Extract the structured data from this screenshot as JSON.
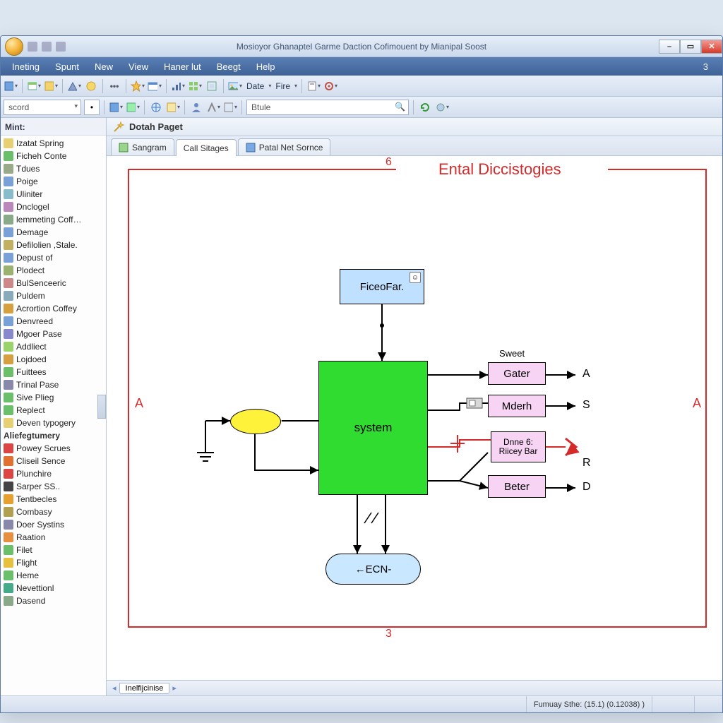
{
  "title": "Mosioyor Ghanaptel Garme Daction Cofimouent by Mianipal Soost",
  "menubar": {
    "items": [
      "Ineting",
      "Spunt",
      "New",
      "View",
      "Haner lut",
      "Beegt",
      "Help"
    ],
    "right_num": "3"
  },
  "toolbar1": {
    "labels": {
      "date": "Date",
      "fire": "Fire"
    }
  },
  "toolbar2": {
    "combo": "scord",
    "search": "Btule"
  },
  "sidebar": {
    "header": "Mint:",
    "items": [
      {
        "label": "Izatat Spring",
        "color": "#e7d073"
      },
      {
        "label": "Ficheh Conte",
        "color": "#6bbf6b"
      },
      {
        "label": "Tdues",
        "color": "#9a8"
      },
      {
        "label": "Poige",
        "color": "#7aa0d8"
      },
      {
        "label": "Uliniter",
        "color": "#8bc"
      },
      {
        "label": "Dnclogel",
        "color": "#b8b"
      },
      {
        "label": "lemmeting Coff…",
        "color": "#8a8"
      },
      {
        "label": "Demage",
        "color": "#7aa0d8"
      },
      {
        "label": "Defilolien ,Stale.",
        "color": "#c0b060"
      },
      {
        "label": "Depust of",
        "color": "#7aa0d8"
      },
      {
        "label": "Plodect",
        "color": "#9bb170"
      },
      {
        "label": "BulSenceeric",
        "color": "#c88"
      },
      {
        "label": "Puldem",
        "color": "#8ab"
      },
      {
        "label": "Acrortion Coffey",
        "color": "#d6a040"
      },
      {
        "label": "Denvreed",
        "color": "#7aa0d8"
      },
      {
        "label": "Mgoer Pase",
        "color": "#88c"
      },
      {
        "label": "Addliect",
        "color": "#9bd36b"
      },
      {
        "label": "Lojdoed",
        "color": "#d6a040"
      },
      {
        "label": "Fuittees",
        "color": "#6bbf6b"
      },
      {
        "label": "Trinal Pase",
        "color": "#88a"
      },
      {
        "label": "Sive Plieg",
        "color": "#6bbf6b"
      },
      {
        "label": "Replect",
        "color": "#6bbf6b"
      },
      {
        "label": "Deven typogery",
        "color": "#e7d073"
      }
    ],
    "group2_label": "Aliefegtumery",
    "items2": [
      {
        "label": "Powey Scrues",
        "color": "#d44"
      },
      {
        "label": "Cliseil Sence",
        "color": "#e27030"
      },
      {
        "label": "Plunchire",
        "color": "#d44"
      },
      {
        "label": "Sarper SS..",
        "color": "#444"
      },
      {
        "label": "Tentbecles",
        "color": "#e7a030"
      },
      {
        "label": "Combasy",
        "color": "#b0a050"
      },
      {
        "label": "Doer Systins",
        "color": "#88a"
      },
      {
        "label": "Raation",
        "color": "#e79040"
      },
      {
        "label": "Filet",
        "color": "#6bbf6b"
      },
      {
        "label": "Flight",
        "color": "#e7c040"
      },
      {
        "label": "Heme",
        "color": "#6bbf6b"
      },
      {
        "label": "Nevettionl",
        "color": "#4a8"
      },
      {
        "label": "Dasend",
        "color": "#8a8"
      }
    ]
  },
  "crumb": "Dotah Paget",
  "tabs": [
    {
      "label": "Sangram"
    },
    {
      "label": "Call Sitages"
    },
    {
      "label": "Patal Net Sornce"
    }
  ],
  "diagram": {
    "title": "Ental Diccistogies",
    "top_num": "6",
    "bottom_num": "3",
    "leftA": "A",
    "rightA": "A",
    "top_box": "FiceoFar.",
    "center": "system",
    "ecn": "←ECN-",
    "sweet": "Sweet",
    "b1": "Gater",
    "b2": "Mderh",
    "b3l1": "Dnne 6:",
    "b3l2": "Riicey Bar",
    "b4": "Beter",
    "outA": "A",
    "outS": "S",
    "outR": "R",
    "outD": "D"
  },
  "bottom_tab": "Inelfijcinise",
  "status": {
    "label": "Fumuay Sthe:",
    "val": "(15.1) (0.12038) )"
  }
}
